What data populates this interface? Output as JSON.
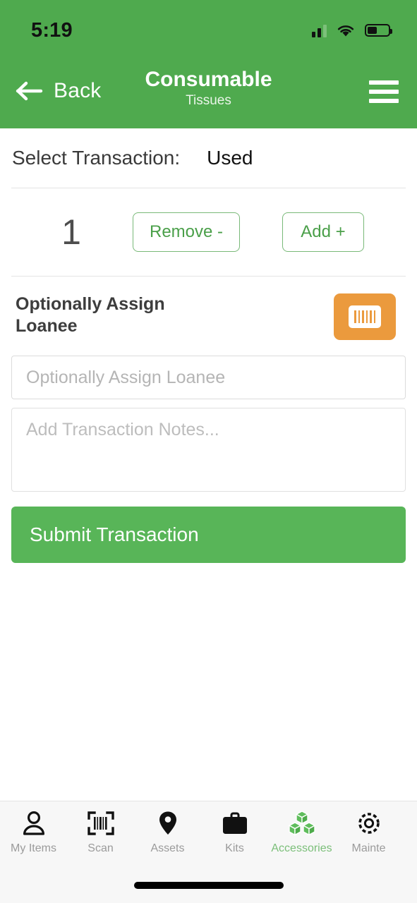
{
  "status_bar": {
    "time": "5:19",
    "signal_icon": "cellular-signal-icon",
    "wifi_icon": "wifi-icon",
    "battery_icon": "battery-icon",
    "battery_level_percent": 40
  },
  "header": {
    "back_label": "Back",
    "back_icon": "arrow-left-icon",
    "title": "Consumable",
    "subtitle": "Tissues",
    "menu_icon": "hamburger-menu-icon",
    "background_color": "#4faa4e"
  },
  "transaction": {
    "select_label": "Select Transaction:",
    "selected_value": "Used",
    "quantity": "1",
    "remove_label": "Remove -",
    "add_label": "Add +",
    "accent_color": "#4a9f49"
  },
  "loanee": {
    "section_label": "Optionally Assign Loanee",
    "scan_icon": "barcode-scan-icon",
    "scan_button_color": "#eb9a3d",
    "input_value": "",
    "input_placeholder": "Optionally Assign Loanee"
  },
  "notes": {
    "value": "",
    "placeholder": "Add Transaction Notes..."
  },
  "submit": {
    "label": "Submit Transaction",
    "color": "#58b558"
  },
  "tabbar": {
    "items": [
      {
        "label": "My Items",
        "icon": "person-icon",
        "active": false
      },
      {
        "label": "Scan",
        "icon": "barcode-scan-icon",
        "active": false
      },
      {
        "label": "Assets",
        "icon": "map-pin-icon",
        "active": false
      },
      {
        "label": "Kits",
        "icon": "briefcase-icon",
        "active": false
      },
      {
        "label": "Accessories",
        "icon": "cubes-icon",
        "active": true
      },
      {
        "label": "Mainte",
        "icon": "gear-icon",
        "active": false
      }
    ],
    "home_indicator": "home-indicator"
  }
}
